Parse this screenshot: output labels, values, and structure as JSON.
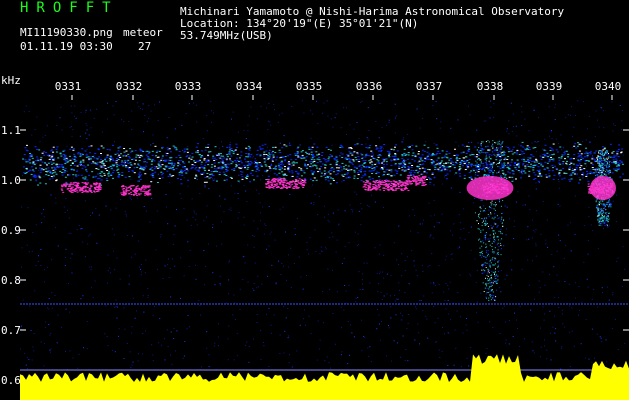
{
  "header": {
    "brand": "HROFFT",
    "filename": "MI11190330.png",
    "meteor_label": "meteor",
    "datetime": "01.11.19 03:30",
    "meteor_count": "27",
    "observer": "Michinari Yamamoto @ Nishi-Harima Astronomical Observatory",
    "location": "Location: 134°20'19\"(E) 35°01'21\"(N)",
    "frequency": "53.749MHz(USB)"
  },
  "axes": {
    "y_unit": "kHz",
    "y_ticks": [
      "1.1",
      "1.0",
      "0.9",
      "0.8",
      "0.7",
      "0.6"
    ],
    "x_ticks": [
      "0331",
      "0332",
      "0333",
      "0334",
      "0335",
      "0336",
      "0337",
      "0338",
      "0339",
      "0340"
    ]
  },
  "colors": {
    "brand": "#19ff19",
    "text": "#ffffff",
    "tick": "#ffffff",
    "background": "#000000",
    "signal_low": "#0a2aff",
    "signal_mid": "#26c6c6",
    "signal_high": "#ff33cc",
    "bottom_power": "#ffff00",
    "marker_line": "#3355ff"
  }
}
